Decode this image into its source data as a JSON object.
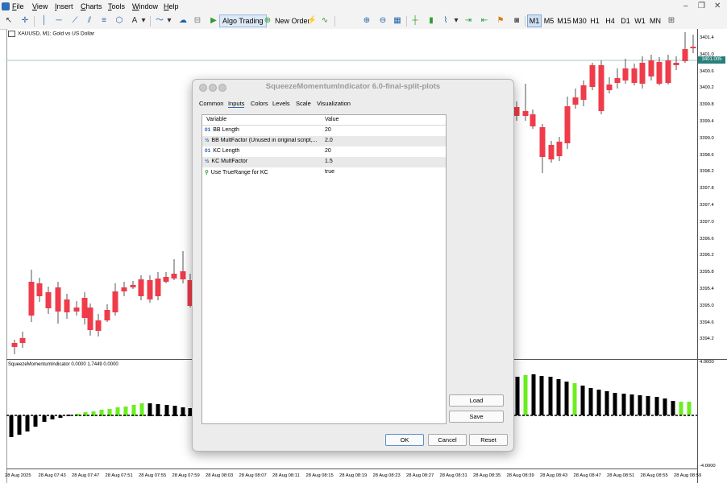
{
  "menu": {
    "items": [
      {
        "label": "File",
        "key": "F"
      },
      {
        "label": "View",
        "key": "V"
      },
      {
        "label": "Insert",
        "key": "I"
      },
      {
        "label": "Charts",
        "key": "C"
      },
      {
        "label": "Tools",
        "key": "T"
      },
      {
        "label": "Window",
        "key": "W"
      },
      {
        "label": "Help",
        "key": "H"
      }
    ]
  },
  "toolbar": {
    "algo_trading": "Algo Trading",
    "new_order": "New Order",
    "timeframes": [
      "M1",
      "M5",
      "M15",
      "M30",
      "H1",
      "H4",
      "D1",
      "W1",
      "MN"
    ],
    "selected_timeframe": "M1"
  },
  "chart": {
    "symbol_label": "XAUUSD, M1:  Gold vs US Dollar",
    "current_price": "3401.005",
    "price_ticks": [
      "3401.4",
      "3401.0",
      "3400.6",
      "3400.2",
      "3399.8",
      "3399.4",
      "3399.0",
      "3398.6",
      "3398.2",
      "3397.8",
      "3397.4",
      "3397.0",
      "3396.6",
      "3396.2",
      "3395.8",
      "3395.4",
      "3395.0",
      "3394.6",
      "3394.2"
    ],
    "indicator_label": "SqueezeMomentumIndicator 0.0000 1.7449 0.0000",
    "indicator_ticks": [
      "4.0000",
      "-4.0000"
    ],
    "time_ticks": [
      "28 Aug 2025",
      "28 Aug 07:43",
      "28 Aug 07:47",
      "28 Aug 07:51",
      "28 Aug 07:55",
      "28 Aug 07:59",
      "28 Aug 08:03",
      "28 Aug 08:07",
      "28 Aug 08:11",
      "28 Aug 08:15",
      "28 Aug 08:19",
      "28 Aug 08:23",
      "28 Aug 08:27",
      "28 Aug 08:31",
      "28 Aug 08:35",
      "28 Aug 08:39",
      "28 Aug 08:43",
      "28 Aug 08:47",
      "28 Aug 08:51",
      "28 Aug 08:55",
      "28 Aug 08:59"
    ],
    "colors": {
      "bull": "#26a69a",
      "bear": "#ef3b4a",
      "hist_pos": "#6aef1f",
      "hist_neg": "#000000"
    }
  },
  "dialog": {
    "title": "SqueezeMomentumIndicator 6.0-final-split-plots",
    "tabs": [
      "Common",
      "Inputs",
      "Colors",
      "Levels",
      "Scale",
      "Visualization"
    ],
    "selected_tab": "Inputs",
    "columns": {
      "variable": "Variable",
      "value": "Value"
    },
    "rows": [
      {
        "icon": "01",
        "variable": "BB Length",
        "value": "20"
      },
      {
        "icon": "½",
        "variable": "BB MultFactor (Unused in original script,...",
        "value": "2.0"
      },
      {
        "icon": "01",
        "variable": "KC Length",
        "value": "20"
      },
      {
        "icon": "½",
        "variable": "KC MultFactor",
        "value": "1.5"
      },
      {
        "icon": "⚲",
        "variable": "Use TrueRange for KC",
        "value": "true"
      }
    ],
    "buttons": {
      "load": "Load",
      "save": "Save",
      "ok": "OK",
      "cancel": "Cancel",
      "reset": "Reset"
    }
  }
}
